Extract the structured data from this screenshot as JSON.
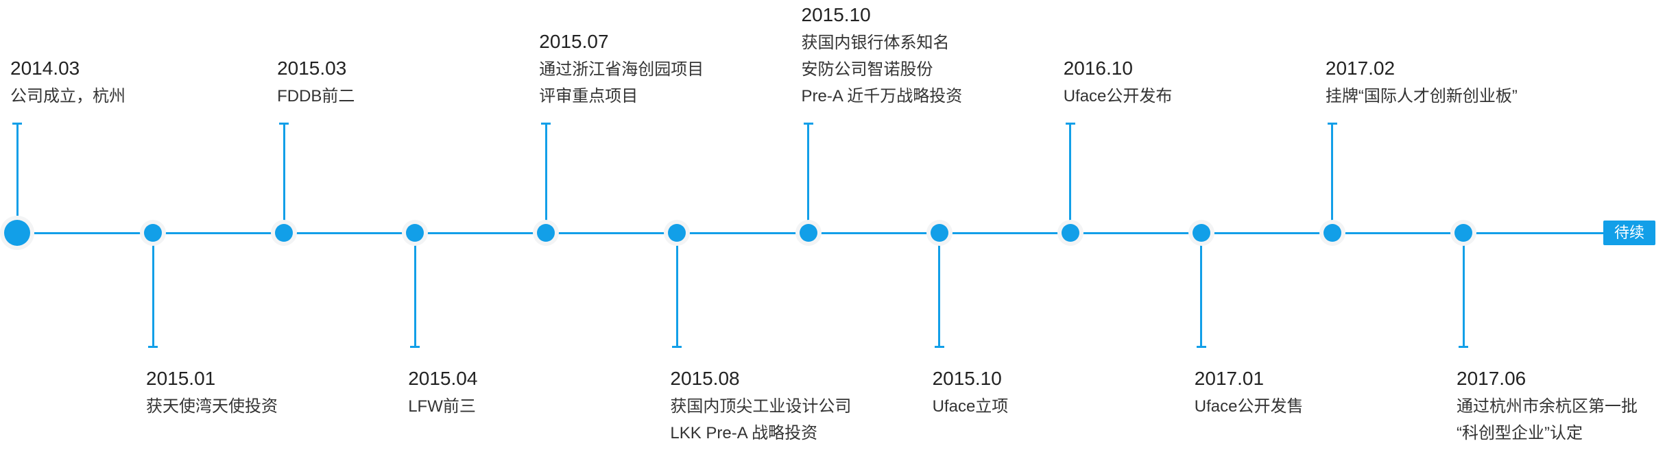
{
  "accent_color": "#129fe8",
  "continue_label": "待续",
  "events": [
    {
      "side": "top",
      "date": "2014.03",
      "lines": [
        "公司成立，杭州"
      ],
      "major": true
    },
    {
      "side": "bottom",
      "date": "2015.01",
      "lines": [
        "获天使湾天使投资"
      ]
    },
    {
      "side": "top",
      "date": "2015.03",
      "lines": [
        "FDDB前二"
      ]
    },
    {
      "side": "bottom",
      "date": "2015.04",
      "lines": [
        "LFW前三"
      ]
    },
    {
      "side": "top",
      "date": "2015.07",
      "lines": [
        "通过浙江省海创园项目",
        "评审重点项目"
      ]
    },
    {
      "side": "bottom",
      "date": "2015.08",
      "lines": [
        "获国内顶尖工业设计公司",
        "LKK Pre-A 战略投资"
      ]
    },
    {
      "side": "top",
      "date": "2015.10",
      "lines": [
        "获国内银行体系知名",
        "安防公司智诺股份",
        "Pre-A 近千万战略投资"
      ]
    },
    {
      "side": "bottom",
      "date": "2015.10",
      "lines": [
        "Uface立项"
      ]
    },
    {
      "side": "top",
      "date": "2016.10",
      "lines": [
        "Uface公开发布"
      ]
    },
    {
      "side": "bottom",
      "date": "2017.01",
      "lines": [
        "Uface公开发售"
      ]
    },
    {
      "side": "top",
      "date": "2017.02",
      "lines": [
        "挂牌“国际人才创新创业板”"
      ]
    },
    {
      "side": "bottom",
      "date": "2017.06",
      "lines": [
        "通过杭州市余杭区第一批",
        "“科创型企业”认定"
      ]
    }
  ]
}
